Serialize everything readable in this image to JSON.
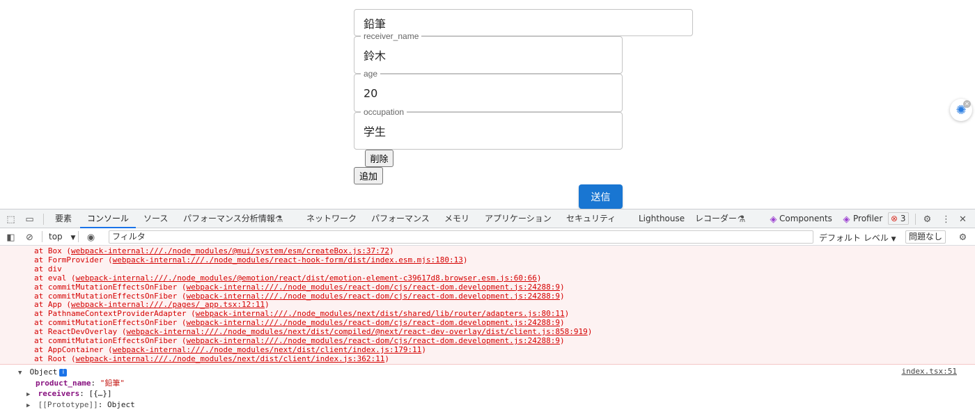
{
  "form": {
    "product_name_value": "鉛筆",
    "receiver": {
      "name_label": "receiver_name",
      "name_value": "鈴木",
      "age_label": "age",
      "age_value": "20",
      "occupation_label": "occupation",
      "occupation_value": "学生"
    },
    "delete_label": "削除",
    "add_label": "追加",
    "submit_label": "送信",
    "submit_color": "#1976d2"
  },
  "devtools": {
    "tabs": [
      "要素",
      "コンソール",
      "ソース",
      "パフォーマンス分析情報",
      "ネットワーク",
      "パフォーマンス",
      "メモリ",
      "アプリケーション",
      "セキュリティ",
      "Lighthouse",
      "レコーダー",
      "Components",
      "Profiler"
    ],
    "active_tab": "コンソール",
    "error_count": "3",
    "context": "top",
    "filter_placeholder": "フィルタ",
    "level": "デフォルト レベル",
    "issues": "問題なし"
  },
  "console": {
    "stack": [
      {
        "fn": "at Box (",
        "link": "webpack-internal:///./node_modules/@mui/system/esm/createBox.js:37:72",
        "end": ")"
      },
      {
        "fn": "at FormProvider (",
        "link": "webpack-internal:///./node_modules/react-hook-form/dist/index.esm.mjs:180:13",
        "end": ")"
      },
      {
        "fn": "at div",
        "link": "",
        "end": ""
      },
      {
        "fn": "at eval (",
        "link": "webpack-internal:///./node_modules/@emotion/react/dist/emotion-element-c39617d8.browser.esm.js:60:66",
        "end": ")"
      },
      {
        "fn": "at commitMutationEffectsOnFiber (",
        "link": "webpack-internal:///./node_modules/react-dom/cjs/react-dom.development.js:24288:9",
        "end": ")"
      },
      {
        "fn": "at commitMutationEffectsOnFiber (",
        "link": "webpack-internal:///./node_modules/react-dom/cjs/react-dom.development.js:24288:9",
        "end": ")"
      },
      {
        "fn": "at App (",
        "link": "webpack-internal:///./pages/_app.tsx:12:11",
        "end": ")"
      },
      {
        "fn": "at PathnameContextProviderAdapter (",
        "link": "webpack-internal:///./node_modules/next/dist/shared/lib/router/adapters.js:80:11",
        "end": ")"
      },
      {
        "fn": "at commitMutationEffectsOnFiber (",
        "link": "webpack-internal:///./node_modules/react-dom/cjs/react-dom.development.js:24288:9",
        "end": ")"
      },
      {
        "fn": "at ReactDevOverlay (",
        "link": "webpack-internal:///./node_modules/next/dist/compiled/@next/react-dev-overlay/dist/client.js:858:919",
        "end": ")"
      },
      {
        "fn": "at commitMutationEffectsOnFiber (",
        "link": "webpack-internal:///./node_modules/react-dom/cjs/react-dom.development.js:24288:9",
        "end": ")"
      },
      {
        "fn": "at AppContainer (",
        "link": "webpack-internal:///./node_modules/next/dist/client/index.js:179:11",
        "end": ")"
      },
      {
        "fn": "at Root (",
        "link": "webpack-internal:///./node_modules/next/dist/client/index.js:362:11",
        "end": ")"
      }
    ],
    "object_label": "Object",
    "source_link": "index.tsx:51",
    "product_key": "product_name",
    "product_value": "\"鉛筆\"",
    "receivers_key": "receivers",
    "receivers_value": "[{…}]",
    "proto_key": "[[Prototype]]",
    "proto_value": "Object"
  }
}
